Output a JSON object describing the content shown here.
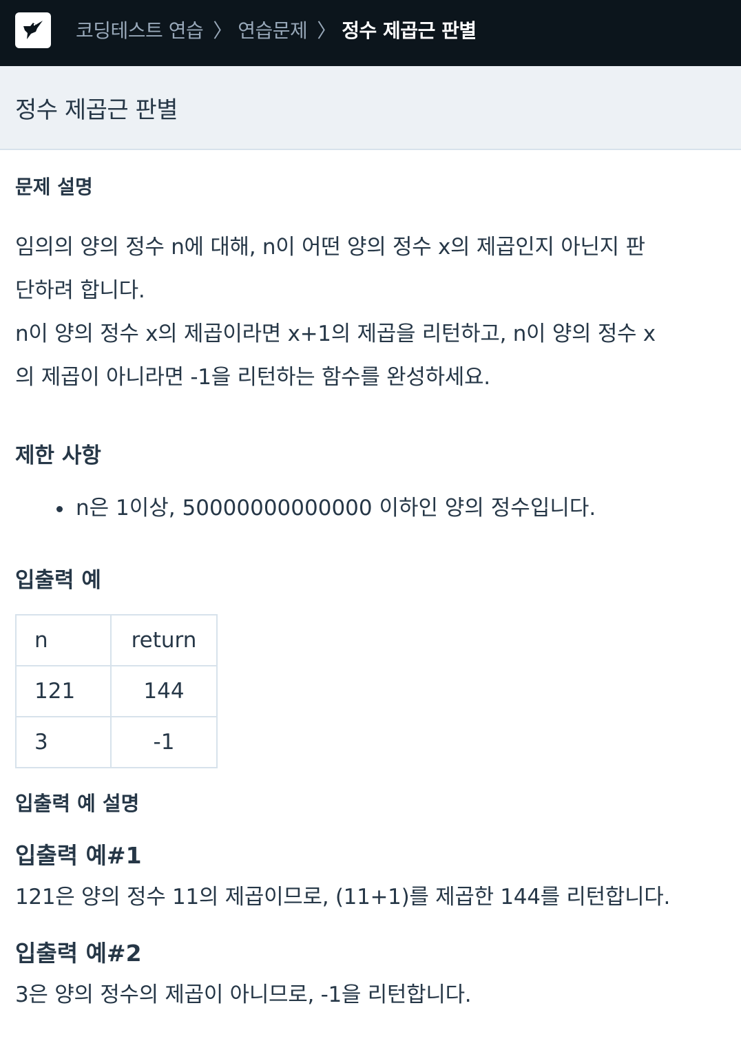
{
  "header": {
    "logo_icon": "hummingbird-logo-icon",
    "breadcrumbs": [
      "코딩테스트 연습",
      "연습문제",
      "정수 제곱근 판별"
    ],
    "separator": "〉"
  },
  "problem": {
    "title": "정수 제곱근 판별",
    "description_heading": "문제 설명",
    "description_lines": [
      "임의의 양의 정수 n에 대해, n이 어떤 양의 정수 x의 제곱인지 아닌지 판",
      "단하려 합니다.",
      "n이 양의 정수 x의 제곱이라면 x+1의 제곱을 리턴하고, n이 양의 정수 x",
      "의 제곱이 아니라면 -1을 리턴하는 함수를 완성하세요."
    ],
    "limits_heading": "제한 사항",
    "limits": [
      "n은 1이상, 50000000000000 이하인 양의 정수입니다."
    ],
    "io_heading": "입출력 예",
    "io_table": {
      "headers": [
        "n",
        "return"
      ],
      "rows": [
        [
          "121",
          "144"
        ],
        [
          "3",
          "-1"
        ]
      ]
    },
    "io_explain_heading": "입출력 예 설명",
    "examples": [
      {
        "title": "입출력 예#1",
        "text": "121은 양의 정수 11의 제곱이므로, (11+1)를 제곱한 144를 리턴합니다."
      },
      {
        "title": "입출력 예#2",
        "text": "3은 양의 정수의 제곱이 아니므로, -1을 리턴합니다."
      }
    ]
  },
  "colors": {
    "topbar_bg": "#0c151c",
    "titlebar_bg": "#edf1f5",
    "text": "#263747",
    "crumb_muted": "#98a8b9",
    "border": "#d7e2eb"
  }
}
